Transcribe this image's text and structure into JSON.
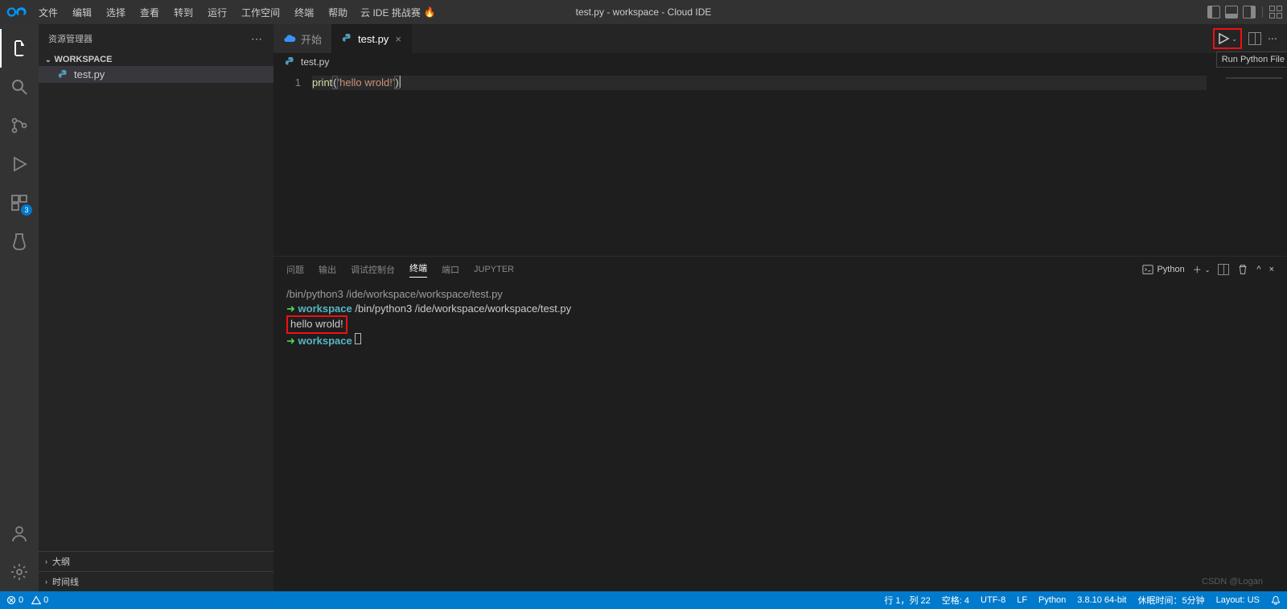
{
  "menubar": {
    "items": [
      "文件",
      "编辑",
      "选择",
      "查看",
      "转到",
      "运行",
      "工作空间",
      "终端",
      "帮助"
    ],
    "challenge_label": "云 IDE 挑战赛",
    "title": "test.py - workspace - Cloud IDE"
  },
  "activitybar": {
    "ext_badge": "3"
  },
  "sidebar": {
    "title": "资源管理器",
    "workspace_label": "WORKSPACE",
    "file": "test.py",
    "outline": "大纲",
    "timeline": "时间线"
  },
  "tabs": {
    "start": "开始",
    "file": "test.py",
    "run_tooltip": "Run Python File"
  },
  "open_editor": {
    "file": "test.py"
  },
  "code": {
    "line_no": "1",
    "fn": "print",
    "lparen": "(",
    "lbrack": "[",
    "str": "'hello wrold!'",
    "rbrack": "]",
    "rparen": ")"
  },
  "panel": {
    "tabs": [
      "问题",
      "输出",
      "调试控制台",
      "终端",
      "端口",
      "JUPYTER"
    ],
    "active_index": 3,
    "shell_label": "Python"
  },
  "terminal": {
    "l1": "/bin/python3 /ide/workspace/workspace/test.py",
    "l2_prefix": "workspace",
    "l2_cmd": "/bin/python3 /ide/workspace/workspace/test.py",
    "output": "hello wrold!",
    "l3_prefix": "workspace"
  },
  "statusbar": {
    "errors": "0",
    "warnings": "0",
    "cursor": "行 1，列 22",
    "spaces": "空格: 4",
    "encoding": "UTF-8",
    "eol": "LF",
    "lang": "Python",
    "py_ver": "3.8.10 64-bit",
    "idle": "休眠时间：5分钟",
    "layout": "Layout: US"
  },
  "watermark": "CSDN @Logan"
}
